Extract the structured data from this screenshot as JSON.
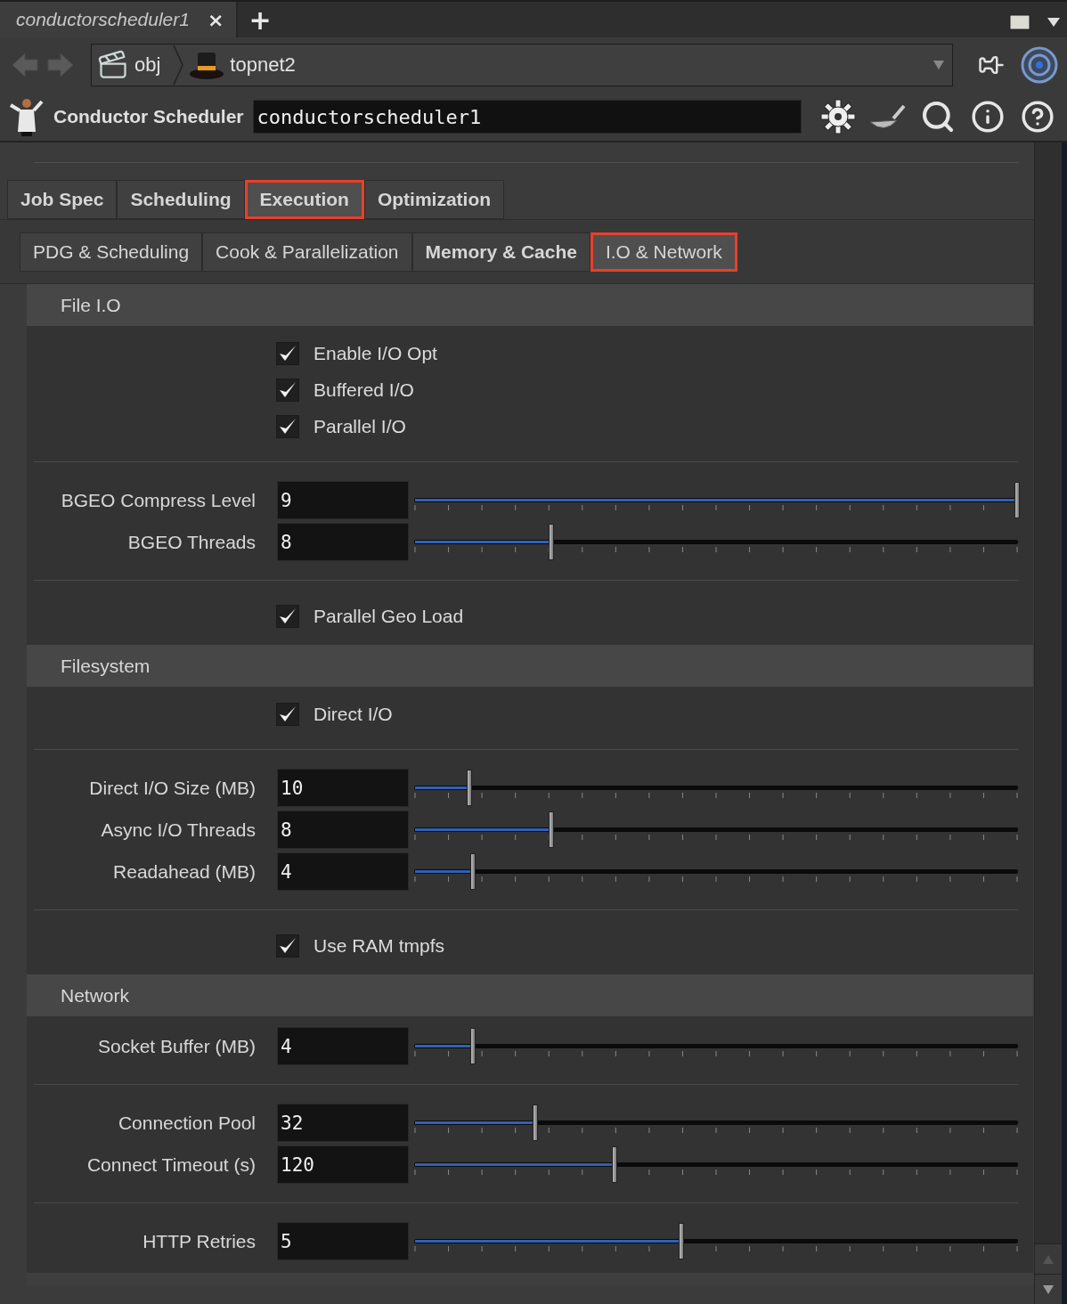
{
  "tab": {
    "title": "conductorscheduler1",
    "close": "×",
    "add": "+"
  },
  "path": [
    {
      "label": "obj",
      "kind": "obj"
    },
    {
      "label": "topnet2",
      "kind": "top"
    }
  ],
  "node": {
    "type": "Conductor Scheduler",
    "name": "conductorscheduler1"
  },
  "tabs": [
    {
      "label": "Job Spec",
      "selected": false,
      "bold": true
    },
    {
      "label": "Scheduling",
      "selected": false,
      "bold": true
    },
    {
      "label": "Execution",
      "selected": true,
      "bold": true
    },
    {
      "label": "Optimization",
      "selected": false,
      "bold": true
    }
  ],
  "subtabs": [
    {
      "label": "PDG & Scheduling",
      "selected": false,
      "bold": false
    },
    {
      "label": "Cook & Parallelization",
      "selected": false,
      "bold": false
    },
    {
      "label": "Memory & Cache",
      "selected": false,
      "bold": true
    },
    {
      "label": "I.O & Network",
      "selected": true,
      "bold": false
    }
  ],
  "sections": [
    {
      "title": "File I.O",
      "items": [
        {
          "kind": "checkbox",
          "label": "Enable I/O Opt",
          "checked": true
        },
        {
          "kind": "checkbox",
          "label": "Buffered I/O",
          "checked": true
        },
        {
          "kind": "checkbox",
          "label": "Parallel I/O",
          "checked": true
        },
        {
          "kind": "divider"
        },
        {
          "kind": "slider",
          "label": "BGEO Compress Level",
          "value": "9",
          "level": 1.0
        },
        {
          "kind": "slider",
          "label": "BGEO Threads",
          "value": "8",
          "level": 0.226
        },
        {
          "kind": "divider"
        },
        {
          "kind": "checkbox",
          "label": "Parallel Geo Load",
          "checked": true
        }
      ]
    },
    {
      "title": "Filesystem",
      "items": [
        {
          "kind": "checkbox",
          "label": "Direct I/O",
          "checked": true
        },
        {
          "kind": "divider"
        },
        {
          "kind": "slider",
          "label": "Direct I/O Size (MB)",
          "value": "10",
          "level": 0.09
        },
        {
          "kind": "slider",
          "label": "Async I/O Threads",
          "value": "8",
          "level": 0.226
        },
        {
          "kind": "slider",
          "label": "Readahead (MB)",
          "value": "4",
          "level": 0.096
        },
        {
          "kind": "divider"
        },
        {
          "kind": "checkbox",
          "label": "Use RAM tmpfs",
          "checked": true
        }
      ]
    },
    {
      "title": "Network",
      "items": [
        {
          "kind": "slider",
          "label": "Socket Buffer (MB)",
          "value": "4",
          "level": 0.096
        },
        {
          "kind": "divider"
        },
        {
          "kind": "slider",
          "label": "Connection Pool",
          "value": "32",
          "level": 0.2
        },
        {
          "kind": "slider",
          "label": "Connect Timeout (s)",
          "value": "120",
          "level": 0.332
        },
        {
          "kind": "divider"
        },
        {
          "kind": "slider",
          "label": "HTTP Retries",
          "value": "5",
          "level": 0.443
        }
      ]
    }
  ]
}
